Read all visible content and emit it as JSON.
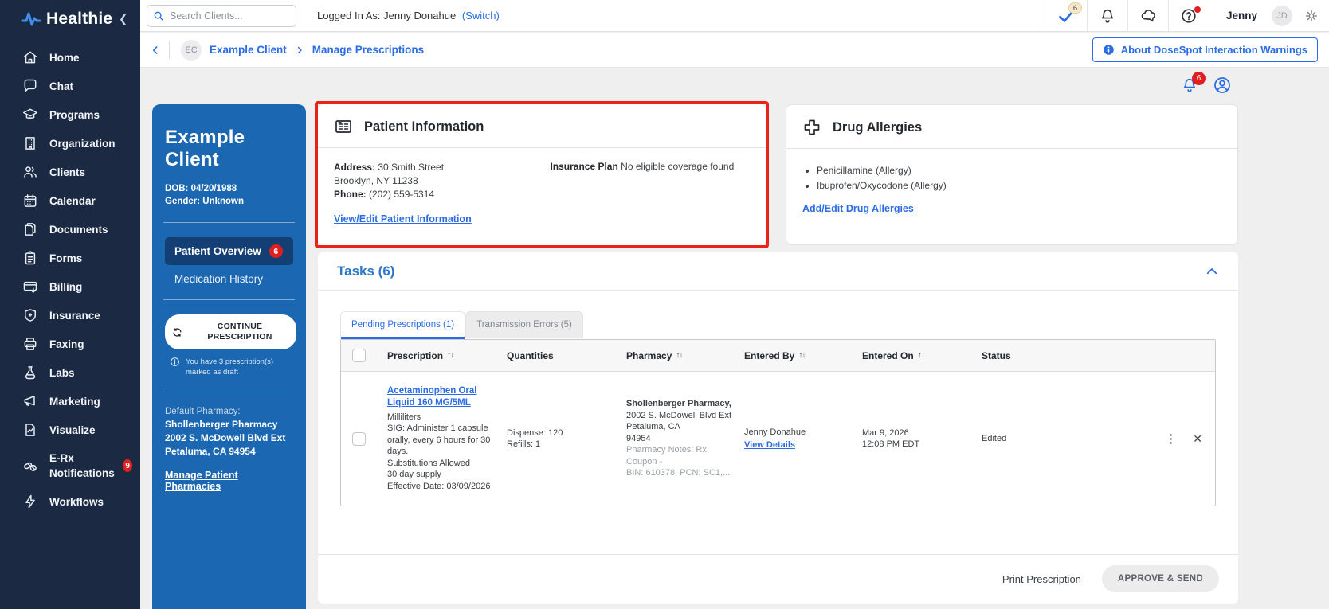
{
  "colors": {
    "sidebar_bg": "#1b2942",
    "client_panel_blue": "#1b67b2",
    "active_nav_blue": "#143f74",
    "accent_link_blue": "#2b6ce5",
    "tasks_header_blue": "#2d79c7",
    "badge_red": "#e02020",
    "highlight_border_red": "#e82318"
  },
  "brand": {
    "name": "Healthie"
  },
  "topbar": {
    "search_placeholder": "Search Clients...",
    "logged_in_label": "Logged In As:",
    "logged_in_name": "Jenny Donahue",
    "switch_label": "(Switch)",
    "check_badge": "6",
    "user_name": "Jenny",
    "avatar_initials": "JD"
  },
  "breadcrumb": {
    "client_initials": "EC",
    "client_name": "Example Client",
    "page_title": "Manage Prescriptions",
    "about_button": "About DoseSpot Interaction Warnings"
  },
  "sidebar": {
    "items": [
      {
        "label": "Home"
      },
      {
        "label": "Chat"
      },
      {
        "label": "Programs"
      },
      {
        "label": "Organization"
      },
      {
        "label": "Clients"
      },
      {
        "label": "Calendar"
      },
      {
        "label": "Documents"
      },
      {
        "label": "Forms"
      },
      {
        "label": "Billing"
      },
      {
        "label": "Insurance"
      },
      {
        "label": "Faxing"
      },
      {
        "label": "Labs"
      },
      {
        "label": "Marketing"
      },
      {
        "label": "Visualize"
      },
      {
        "label": "E-Rx Notifications",
        "badge": "9"
      },
      {
        "label": "Workflows"
      }
    ]
  },
  "content_header": {
    "notifications_badge": "6"
  },
  "client_panel": {
    "name": "Example Client",
    "dob_line": "DOB: 04/20/1988",
    "gender_line": "Gender: Unknown",
    "nav_active_label": "Patient Overview",
    "nav_active_badge": "6",
    "nav_secondary_label": "Medication History",
    "continue_button": "CONTINUE PRESCRIPTION",
    "draft_note": "You have 3 prescription(s) marked as draft",
    "default_pharmacy_label": "Default Pharmacy:",
    "pharmacy_name": "Shollenberger Pharmacy",
    "pharmacy_addr1": "2002 S. McDowell Blvd Ext",
    "pharmacy_addr2": "Petaluma, CA 94954",
    "manage_link": "Manage Patient Pharmacies"
  },
  "patient_info": {
    "title": "Patient Information",
    "address_label": "Address:",
    "address_value": "30 Smith Street",
    "address_line2": "Brooklyn, NY 11238",
    "phone_label": "Phone:",
    "phone_value": "(202) 559-5314",
    "edit_link": "View/Edit Patient Information",
    "insurance_label": "Insurance Plan",
    "insurance_value": "No eligible coverage found"
  },
  "drug_allergies": {
    "title": "Drug Allergies",
    "items": [
      {
        "label": "Penicillamine (Allergy)"
      },
      {
        "label": "Ibuprofen/Oxycodone (Allergy)"
      }
    ],
    "edit_link": "Add/Edit Drug Allergies"
  },
  "tasks": {
    "title": "Tasks (6)",
    "tabs": [
      {
        "label": "Pending Prescriptions (1)"
      },
      {
        "label": "Transmission Errors (5)"
      }
    ],
    "columns": [
      {
        "label": "Prescription"
      },
      {
        "label": "Quantities"
      },
      {
        "label": "Pharmacy"
      },
      {
        "label": "Entered By"
      },
      {
        "label": "Entered On"
      },
      {
        "label": "Status"
      }
    ],
    "row": {
      "drug_link": "Acetaminophen Oral Liquid 160 MG/5ML",
      "unit": "Milliliters",
      "sig": "SIG: Administer 1 capsule orally, every 6 hours for 30 days.",
      "substitutions": "Substitutions Allowed",
      "supply": "30 day supply",
      "effective": "Effective Date: 03/09/2026",
      "dispense": "Dispense: 120",
      "refills": "Refills: 1",
      "pharmacy_name": "Shollenberger Pharmacy,",
      "pharmacy_line1": "2002 S. McDowell Blvd Ext",
      "pharmacy_line2": "Petaluma, CA",
      "pharmacy_line3": "94954",
      "pharmacy_note1": "Pharmacy Notes: Rx Coupon -",
      "pharmacy_note2": "BIN: 610378, PCN: SC1,...",
      "entered_by": "Jenny Donahue",
      "view_details_link": "View Details",
      "entered_on_date": "Mar 9, 2026",
      "entered_on_time": "12:08 PM EDT",
      "status": "Edited"
    },
    "footer": {
      "print_label": "Print Prescription",
      "approve_label": "APPROVE & SEND"
    }
  },
  "icons": {
    "sort": "↑↓",
    "kebab": "⋮",
    "close": "✕"
  }
}
